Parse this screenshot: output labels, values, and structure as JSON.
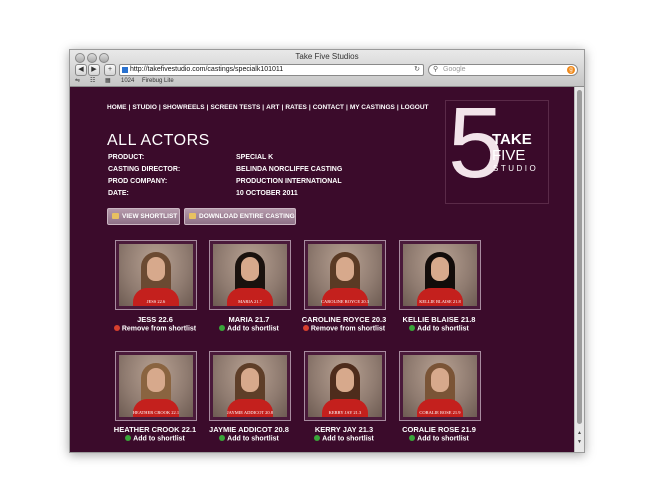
{
  "browser": {
    "window_title": "Take Five Studios",
    "url": "http://takefivestudio.com/castings/specialk101011",
    "search_placeholder": "Google",
    "bookmarks": [
      "1024",
      "Firebug Lite"
    ]
  },
  "nav": {
    "items": [
      "HOME",
      "STUDIO",
      "SHOWREELS",
      "SCREEN TESTS",
      "ART",
      "RATES",
      "CONTACT",
      "MY CASTINGS",
      "LOGOUT"
    ],
    "separator": "|"
  },
  "page": {
    "title": "ALL ACTORS"
  },
  "details": [
    {
      "label": "PRODUCT:",
      "value": "SPECIAL K"
    },
    {
      "label": "CASTING DIRECTOR:",
      "value": "BELINDA NORCLIFFE CASTING"
    },
    {
      "label": "PROD COMPANY:",
      "value": "PRODUCTION INTERNATIONAL"
    },
    {
      "label": "DATE:",
      "value": "10 OCTOBER 2011"
    }
  ],
  "logo": {
    "number": "5",
    "line1": "TAKE",
    "line2": "FIVE",
    "line3": "STUDIO"
  },
  "buttons": {
    "view_shortlist": "VIEW SHORTLIST",
    "download": "DOWNLOAD ENTIRE CASTING"
  },
  "actors": [
    {
      "name": "JESS 22.6",
      "caption": "JESS 22.6",
      "action": "Remove from shortlist",
      "state": "remove",
      "hair": "#6b4a32"
    },
    {
      "name": "MARIA 21.7",
      "caption": "MARIA 21.7",
      "action": "Add to shortlist",
      "state": "add",
      "hair": "#1a120e"
    },
    {
      "name": "CAROLINE ROYCE 20.3",
      "caption": "CAROLINE ROYCE 20.3",
      "action": "Remove from shortlist",
      "state": "remove",
      "hair": "#5a3a24"
    },
    {
      "name": "KELLIE BLAISE 21.8",
      "caption": "KELLIE BLAISE 21.8",
      "action": "Add to shortlist",
      "state": "add",
      "hair": "#120c0a"
    },
    {
      "name": "HEATHER CROOK 22.1",
      "caption": "HEATHER CROOK 22.1",
      "action": "Add to shortlist",
      "state": "add",
      "hair": "#8a6440"
    },
    {
      "name": "JAYMIE ADDICOT 20.8",
      "caption": "JAYMIE ADDICOT 20.8",
      "action": "Add to shortlist",
      "state": "add",
      "hair": "#5e3e28"
    },
    {
      "name": "KERRY JAY 21.3",
      "caption": "KERRY JAY 21.3",
      "action": "Add to shortlist",
      "state": "add",
      "hair": "#4e2c1c"
    },
    {
      "name": "CORALIE ROSE 21.9",
      "caption": "CORALIE ROSE 21.9",
      "action": "Add to shortlist",
      "state": "add",
      "hair": "#7a5436"
    }
  ]
}
